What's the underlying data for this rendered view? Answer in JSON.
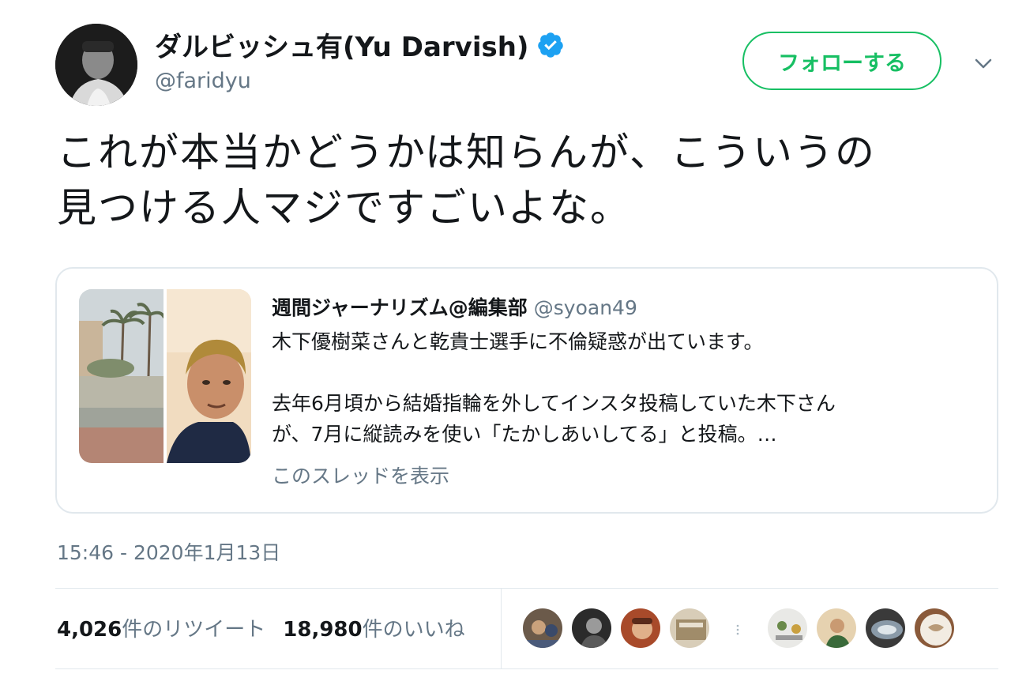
{
  "author": {
    "display_name": "ダルビッシュ有(Yu Darvish)",
    "handle": "@faridyu",
    "verified": true
  },
  "follow_button": {
    "label": "フォローする"
  },
  "tweet": {
    "line1": "これが本当かどうかは知らんが、こういうの",
    "line2": "見つける人マジですごいよな。"
  },
  "quote": {
    "name": "週間ジャーナリズム@編集部",
    "handle": "@syoan49",
    "line1": "木下優樹菜さんと乾貴士選手に不倫疑惑が出ています。",
    "line2": "去年6月頃から結婚指輪を外してインスタ投稿していた木下さん",
    "line3": "が、7月に縦読みを使い「たかしあいしてる」と投稿。…",
    "show_thread": "このスレッドを表示"
  },
  "timestamp": "15:46 - 2020年1月13日",
  "stats": {
    "retweets_num": "4,026",
    "retweets_label": "件のリツイート",
    "likes_num": "18,980",
    "likes_label": "件のいいね"
  },
  "colors": {
    "accent_green": "#17bf63",
    "verified_blue": "#1da1f2",
    "secondary_text": "#657786",
    "border": "#e1e8ed"
  }
}
